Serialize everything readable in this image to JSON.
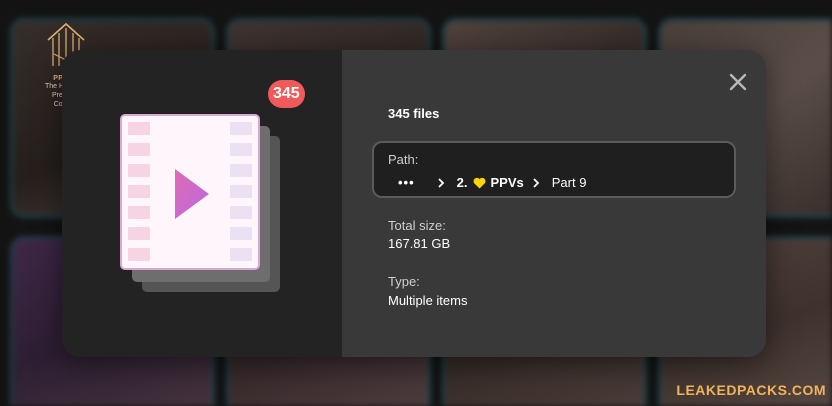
{
  "logo": {
    "name": "PPACK",
    "tagline_1": "The House of",
    "tagline_2": "Premium",
    "tagline_3": "Content"
  },
  "modal": {
    "file_count_badge": "345",
    "files_label": "345 files",
    "path": {
      "label": "Path:",
      "more": "•••",
      "crumb_1": "2.",
      "crumb_1_emoji": "yellow-heart",
      "crumb_1_text": "PPVs",
      "crumb_2": "Part 9"
    },
    "total_size": {
      "label": "Total size:",
      "value": "167.81 GB"
    },
    "type": {
      "label": "Type:",
      "value": "Multiple items"
    }
  },
  "watermark": "LEAKEDPACKS.COM",
  "colors": {
    "badge": "#f05a5a",
    "watermark": "#f0b45a",
    "heart": "#ffd400",
    "play": "#c86ad0"
  }
}
